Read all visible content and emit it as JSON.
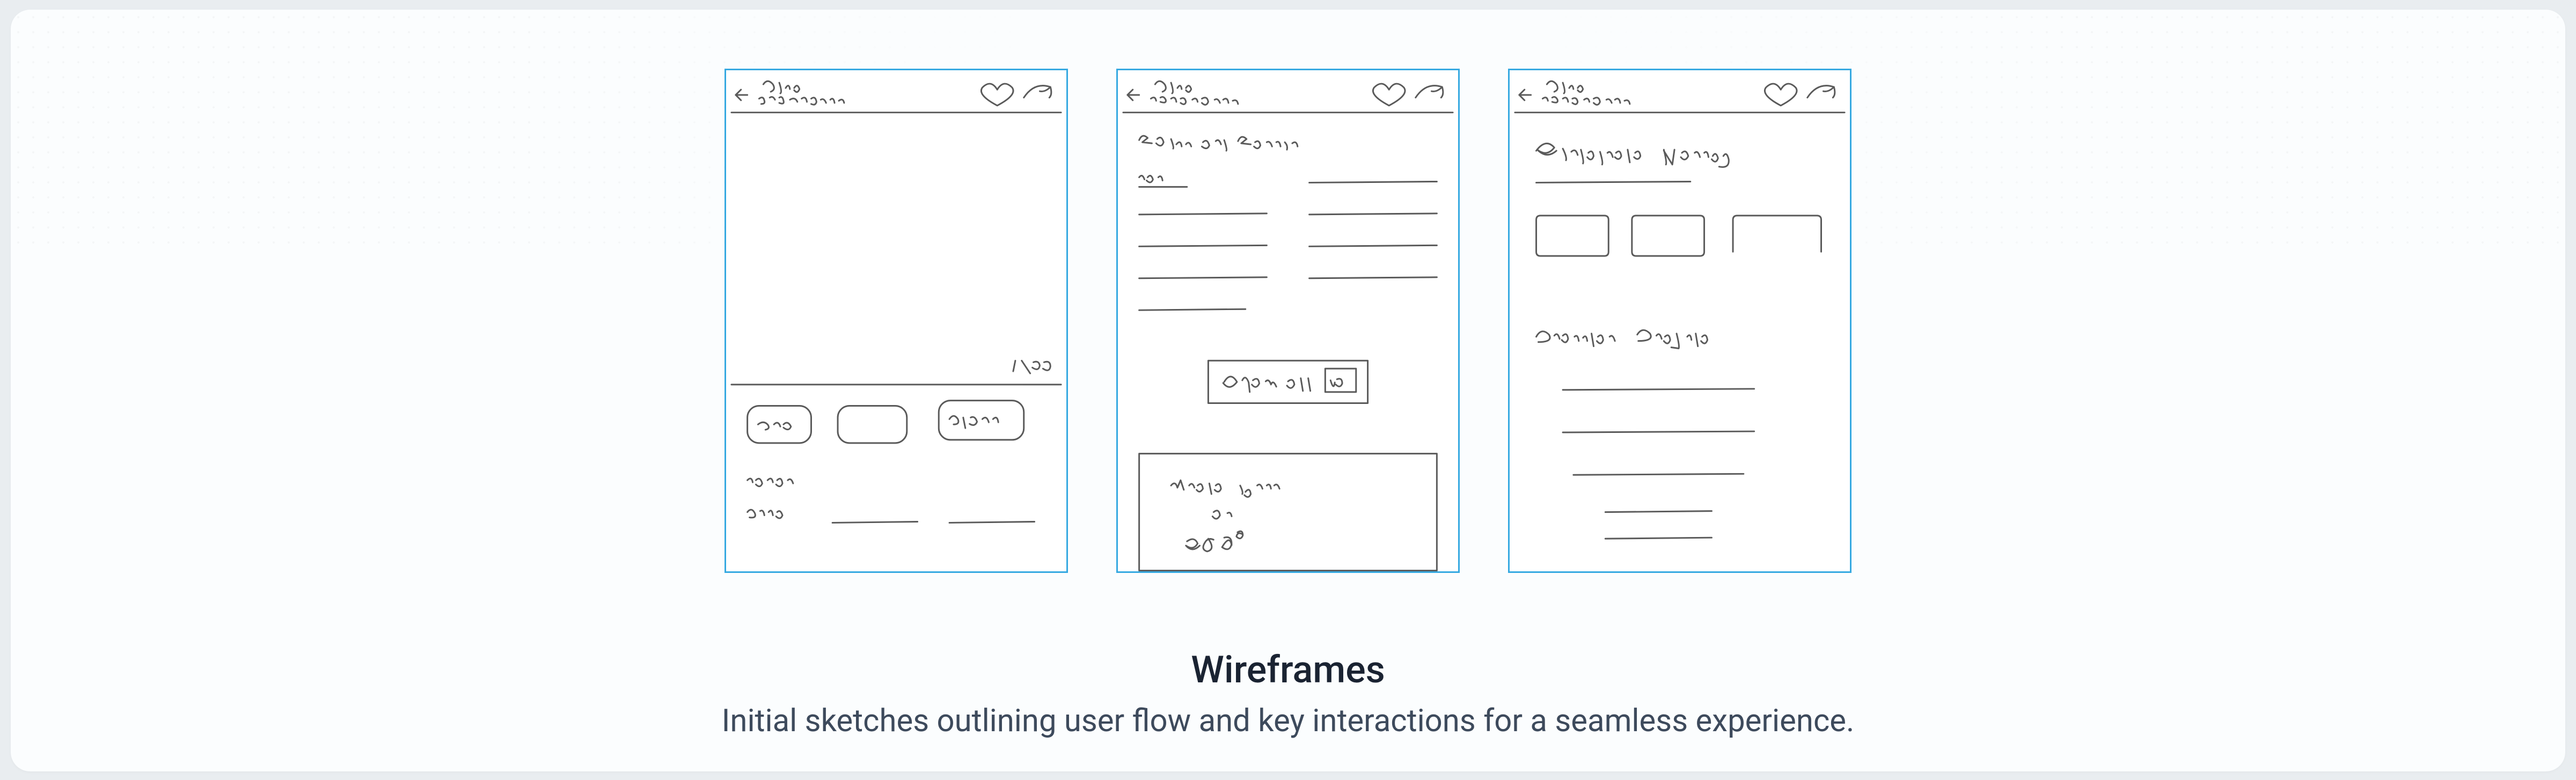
{
  "caption": {
    "title": "Wireframes",
    "subtitle": "Initial sketches outlining user flow and key interactions for a seamless experience."
  },
  "wireframes": [
    {
      "header": {
        "back": true,
        "line1": "Price",
        "line2": "major details",
        "icons": [
          "heart",
          "share"
        ]
      },
      "body": {
        "image_counter": "1/20",
        "chips": [
          "map",
          "",
          "plan"
        ],
        "labels": [
          "name",
          "price"
        ]
      }
    },
    {
      "header": {
        "back": true,
        "line1": "Price",
        "line2": "major details",
        "icons": [
          "heart",
          "share"
        ]
      },
      "body": {
        "section_title": "Facts and Features",
        "show_all_button": "Show all",
        "show_all_count": "40",
        "lower_block": "Video tour or 360°"
      }
    },
    {
      "header": {
        "back": true,
        "line1": "Price",
        "line2": "major details",
        "icons": [
          "heart",
          "share"
        ]
      },
      "body": {
        "section_title_1": "Schedule Viewing",
        "date_boxes": 3,
        "section_title_2": "Provider Profile"
      }
    }
  ]
}
